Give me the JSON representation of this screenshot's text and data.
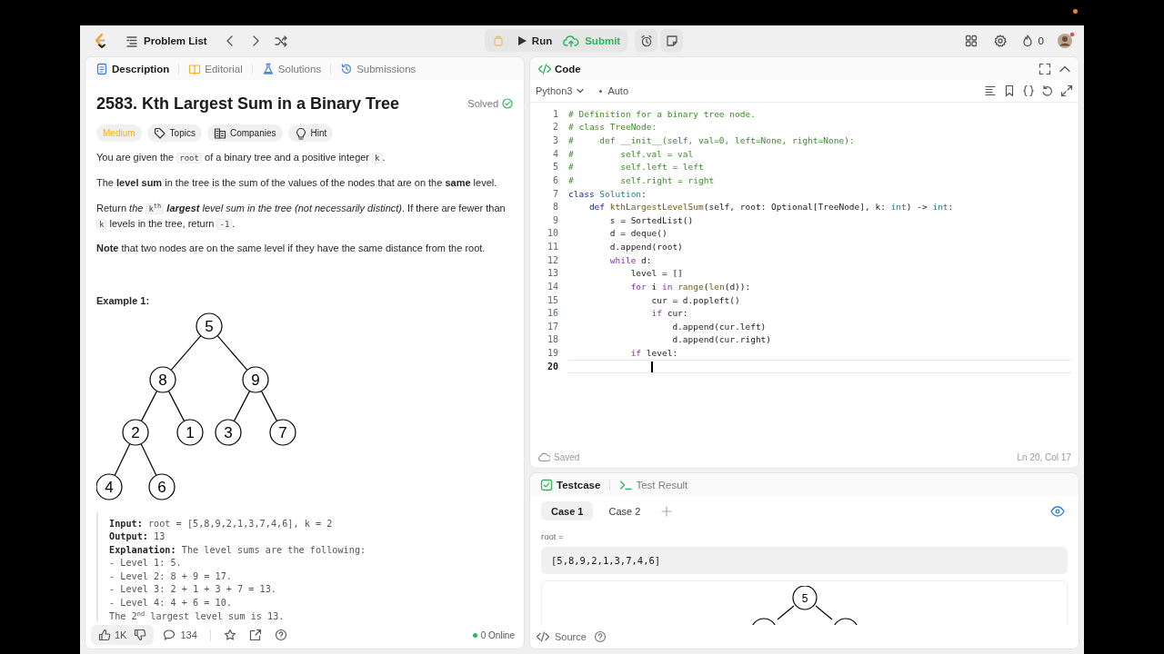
{
  "top_bar": {
    "problem_list": "Problem List",
    "run": "Run",
    "submit": "Submit",
    "streak": "0"
  },
  "description_tabs": [
    {
      "label": "Description",
      "kind": "description",
      "selected": true
    },
    {
      "label": "Editorial",
      "kind": "editorial",
      "selected": false
    },
    {
      "label": "Solutions",
      "kind": "solutions",
      "selected": false
    },
    {
      "label": "Submissions",
      "kind": "submissions",
      "selected": false
    }
  ],
  "problem": {
    "title": "2583. Kth Largest Sum in a Binary Tree",
    "status": "Solved",
    "difficulty": "Medium",
    "tags": [
      {
        "label": "Topics",
        "kind": "topics"
      },
      {
        "label": "Companies",
        "kind": "companies"
      },
      {
        "label": "Hint",
        "kind": "hint"
      }
    ],
    "paragraphs": [
      [
        {
          "text": "You are given the "
        },
        {
          "text": "root",
          "kind": "code"
        },
        {
          "text": " of a binary tree and a positive integer "
        },
        {
          "text": "k",
          "kind": "code"
        },
        {
          "text": "."
        }
      ],
      [
        {
          "text": "The **level sum** in the tree is the sum of the values of the nodes that are on the **same** level."
        }
      ],
      [
        {
          "text": "Return "
        },
        {
          "text": "the ",
          "kind": "emph"
        },
        {
          "text": "k$^{th}$",
          "kind": "code"
        },
        {
          "text": " **largest** level sum in the tree (not necessarily distinct)",
          "kind": "emph"
        },
        {
          "text": ". If there are fewer than "
        },
        {
          "text": "k",
          "kind": "code"
        },
        {
          "text": " levels in the tree, return "
        },
        {
          "text": "-1",
          "kind": "code"
        },
        {
          "text": "."
        }
      ],
      [
        {
          "text": "**Note** that two nodes are on the same level if they have the same distance from the root."
        }
      ]
    ],
    "example_title": "Example 1:",
    "tree": {
      "value": "5",
      "children": [
        {
          "value": "8",
          "children": [
            {
              "value": "2",
              "children": [
                {
                  "value": "4"
                },
                {
                  "value": "6"
                }
              ]
            },
            {
              "value": "1"
            }
          ]
        },
        {
          "value": "9",
          "children": [
            {
              "value": "3"
            },
            {
              "value": "7"
            }
          ]
        }
      ]
    },
    "example_lines": [
      "**Input:** root = [5,8,9,2,1,3,7,4,6], k = 2",
      "**Output:** 13",
      "**Explanation:** The level sums are the following:",
      "- Level 1: 5.",
      "- Level 2: 8 + 9 = 17.",
      "- Level 3: 2 + 1 + 3 + 7 = 13.",
      "- Level 4: 4 + 6 = 10.",
      "The 2$^{nd}$ largest level sum is 13."
    ]
  },
  "footer": {
    "likes": "1K",
    "comments": "134",
    "online": "0 Online"
  },
  "code_panel": {
    "title": "Code",
    "language": "Python3",
    "mode": "Auto",
    "saved": "Saved",
    "position": "Ln 20, Col 17",
    "lines": [
      {
        "number": "1",
        "current": false,
        "tokens": [
          {
            "text": "# Definition for a binary tree node.",
            "kind": "comment"
          }
        ]
      },
      {
        "number": "2",
        "current": false,
        "tokens": [
          {
            "text": "# class TreeNode:",
            "kind": "comment"
          }
        ]
      },
      {
        "number": "3",
        "current": false,
        "tokens": [
          {
            "text": "#     def __init__(self, val=0, left=None, right=None):",
            "kind": "comment"
          }
        ]
      },
      {
        "number": "4",
        "current": false,
        "tokens": [
          {
            "text": "#         self.val = val",
            "kind": "comment"
          }
        ]
      },
      {
        "number": "5",
        "current": false,
        "tokens": [
          {
            "text": "#         self.left = left",
            "kind": "comment"
          }
        ]
      },
      {
        "number": "6",
        "current": false,
        "tokens": [
          {
            "text": "#         self.right = right",
            "kind": "comment"
          }
        ]
      },
      {
        "number": "7",
        "current": false,
        "tokens": [
          {
            "text": "class",
            "kind": "keyword"
          },
          {
            "text": " Solution",
            "kind": "type"
          },
          {
            "text": ":",
            "kind": "plain"
          }
        ]
      },
      {
        "number": "8",
        "current": false,
        "tokens": [
          {
            "text": "    def",
            "kind": "keyword"
          },
          {
            "text": " kthLargestLevelSum",
            "kind": "function"
          },
          {
            "text": "(self, root: Optional[TreeNode], k: ",
            "kind": "plain"
          },
          {
            "text": "int",
            "kind": "type"
          },
          {
            "text": ") -> ",
            "kind": "plain"
          },
          {
            "text": "int",
            "kind": "type"
          },
          {
            "text": ":",
            "kind": "plain"
          }
        ]
      },
      {
        "number": "9",
        "current": false,
        "tokens": [
          {
            "text": "        s = SortedList()",
            "kind": "plain"
          }
        ]
      },
      {
        "number": "10",
        "current": false,
        "tokens": [
          {
            "text": "        d = deque()",
            "kind": "plain"
          }
        ]
      },
      {
        "number": "11",
        "current": false,
        "tokens": [
          {
            "text": "        d.append(root)",
            "kind": "plain"
          }
        ]
      },
      {
        "number": "12",
        "current": false,
        "tokens": [
          {
            "text": "        while",
            "kind": "control"
          },
          {
            "text": " d:",
            "kind": "plain"
          }
        ]
      },
      {
        "number": "13",
        "current": false,
        "tokens": [
          {
            "text": "            level = []",
            "kind": "plain"
          }
        ]
      },
      {
        "number": "14",
        "current": false,
        "tokens": [
          {
            "text": "            for",
            "kind": "control"
          },
          {
            "text": " i ",
            "kind": "plain"
          },
          {
            "text": "in",
            "kind": "control"
          },
          {
            "text": " range",
            "kind": "function"
          },
          {
            "text": "(",
            "kind": "plain"
          },
          {
            "text": "len",
            "kind": "function"
          },
          {
            "text": "(d)):",
            "kind": "plain"
          }
        ]
      },
      {
        "number": "15",
        "current": false,
        "tokens": [
          {
            "text": "                cur = d.popleft()",
            "kind": "plain"
          }
        ]
      },
      {
        "number": "16",
        "current": false,
        "tokens": [
          {
            "text": "                if",
            "kind": "control"
          },
          {
            "text": " cur:",
            "kind": "plain"
          }
        ]
      },
      {
        "number": "17",
        "current": false,
        "tokens": [
          {
            "text": "                    d.append(cur.left)",
            "kind": "plain"
          }
        ]
      },
      {
        "number": "18",
        "current": false,
        "tokens": [
          {
            "text": "                    d.append(cur.right)",
            "kind": "plain"
          }
        ]
      },
      {
        "number": "19",
        "current": false,
        "tokens": [
          {
            "text": "            if",
            "kind": "control"
          },
          {
            "text": " level:",
            "kind": "plain"
          }
        ]
      },
      {
        "number": "20",
        "current": true
      }
    ]
  },
  "testcase_panel": {
    "tabs": [
      {
        "label": "Testcase",
        "kind": "testcase",
        "selected": true
      },
      {
        "label": "Test Result",
        "kind": "result",
        "selected": false
      }
    ],
    "cases": [
      {
        "label": "Case 1",
        "selected": true
      },
      {
        "label": "Case 2",
        "selected": false
      }
    ],
    "param_label": "root =",
    "param_value": "[5,8,9,2,1,3,7,4,6]",
    "preview_root": "5",
    "source": "Source"
  }
}
